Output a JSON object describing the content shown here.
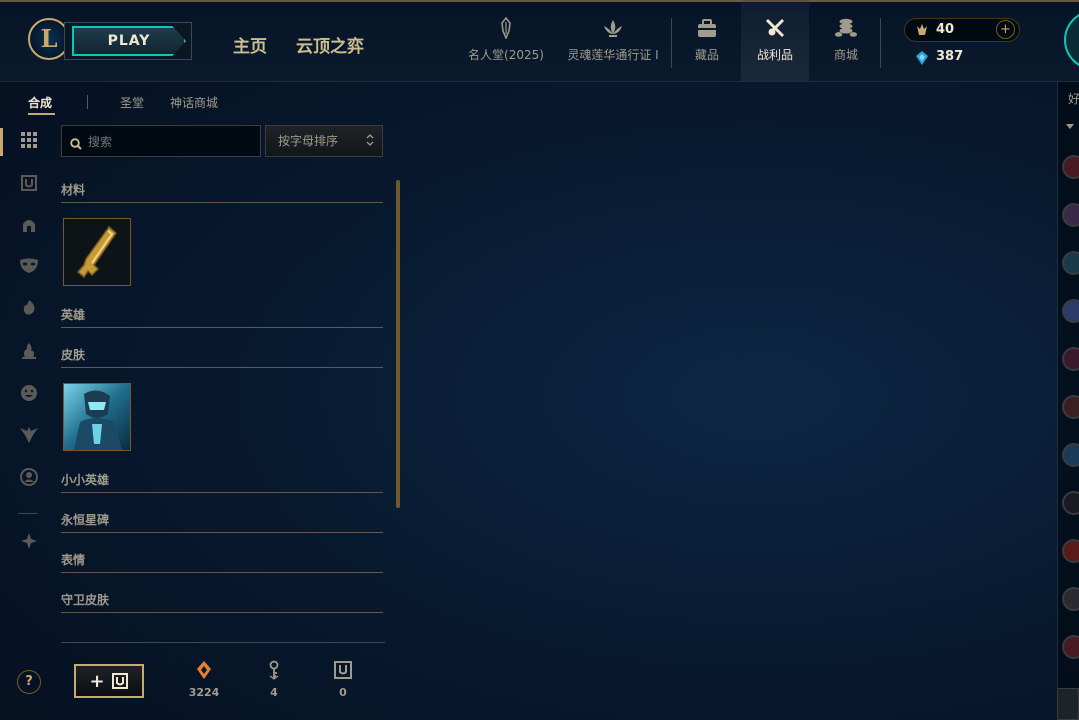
{
  "header": {
    "logo_letter": "L",
    "play_label": "PLAY",
    "nav_main": [
      "主页",
      "云顶之弈"
    ],
    "nav_icons": [
      {
        "label": "名人堂(2025)",
        "icon": "trophy-icon"
      },
      {
        "label": "灵魂莲华通行证 I",
        "icon": "lotus-icon"
      },
      {
        "label": "藏品",
        "icon": "collection-bag-icon"
      },
      {
        "label": "战利品",
        "icon": "loot-icon"
      },
      {
        "label": "商城",
        "icon": "store-coins-icon"
      }
    ],
    "rp": "40",
    "be": "387",
    "add_currency": "+"
  },
  "subnav": {
    "tabs": [
      "合成",
      "圣堂",
      "神话商城"
    ],
    "active": "合成"
  },
  "search": {
    "placeholder": "搜索"
  },
  "sort": {
    "selected": "按字母排序"
  },
  "categories": [
    {
      "label": "材料"
    },
    {
      "label": "英雄"
    },
    {
      "label": "皮肤"
    },
    {
      "label": "小小英雄"
    },
    {
      "label": "永恒星碑"
    },
    {
      "label": "表情"
    },
    {
      "label": "守卫皮肤"
    }
  ],
  "items": {
    "material_item": "hextech-key-fragment-icon",
    "skin_item": "champion-skin-portrait"
  },
  "footer": {
    "help": "?",
    "add_label": "+",
    "stats": [
      {
        "icon": "orange-essence-icon",
        "value": "3224"
      },
      {
        "icon": "key-icon",
        "value": "4"
      },
      {
        "icon": "chest-icon",
        "value": "0"
      }
    ]
  },
  "right_rail": {
    "label": "好"
  },
  "colors": {
    "gold": "#c8aa6e",
    "teal": "#0ac8b9",
    "bg": "#081a30"
  }
}
